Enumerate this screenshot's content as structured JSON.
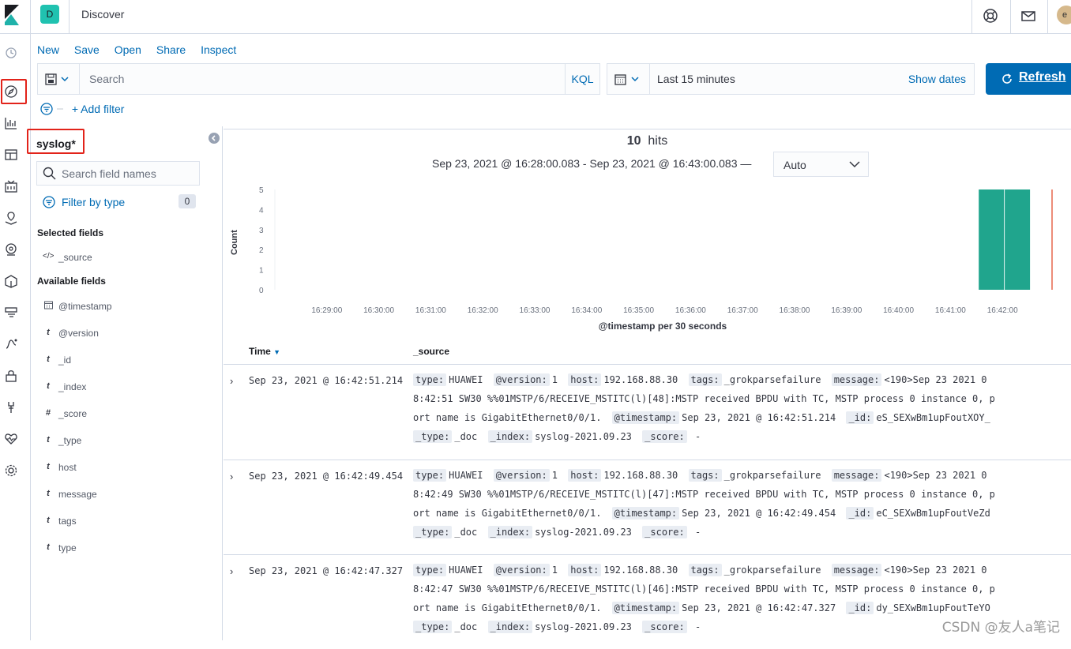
{
  "header": {
    "space_initial": "D",
    "app_title": "Discover",
    "avatar_initial": "e"
  },
  "menu": [
    "New",
    "Save",
    "Open",
    "Share",
    "Inspect"
  ],
  "query": {
    "placeholder": "Search",
    "language": "KQL",
    "time_range": "Last 15 minutes",
    "show_dates": "Show dates",
    "refresh": "Refresh"
  },
  "filters": {
    "add_filter": "+ Add filter"
  },
  "sidebar": {
    "index_pattern": "syslog*",
    "field_search_placeholder": "Search field names",
    "filter_by_type": "Filter by type",
    "filter_count": "0",
    "selected_title": "Selected fields",
    "selected_fields": [
      {
        "type": "</>",
        "name": "_source"
      }
    ],
    "available_title": "Available fields",
    "available_fields": [
      {
        "type": "cal",
        "name": "@timestamp"
      },
      {
        "type": "t",
        "name": "@version"
      },
      {
        "type": "t",
        "name": "_id"
      },
      {
        "type": "t",
        "name": "_index"
      },
      {
        "type": "#",
        "name": "_score"
      },
      {
        "type": "t",
        "name": "_type"
      },
      {
        "type": "t",
        "name": "host"
      },
      {
        "type": "t",
        "name": "message"
      },
      {
        "type": "t",
        "name": "tags"
      },
      {
        "type": "t",
        "name": "type"
      }
    ]
  },
  "results": {
    "hits_count": "10",
    "hits_label": "hits",
    "date_range": "Sep 23, 2021 @ 16:28:00.083 - Sep 23, 2021 @ 16:43:00.083 —",
    "interval": "Auto",
    "col_time": "Time",
    "col_source": "_source"
  },
  "chart_data": {
    "type": "bar",
    "ylabel": "Count",
    "xlabel": "@timestamp per 30 seconds",
    "ylim": [
      0,
      5
    ],
    "yticks": [
      "5",
      "4",
      "3",
      "2",
      "1",
      "0"
    ],
    "xticks": [
      "16:29:00",
      "16:30:00",
      "16:31:00",
      "16:32:00",
      "16:33:00",
      "16:34:00",
      "16:35:00",
      "16:36:00",
      "16:37:00",
      "16:38:00",
      "16:39:00",
      "16:40:00",
      "16:41:00",
      "16:42:00"
    ],
    "bars": [
      {
        "x": "16:42:00",
        "value": 5
      },
      {
        "x": "16:42:30",
        "value": 5
      }
    ],
    "bar_color": "#20a58d"
  },
  "rows": [
    {
      "time": "Sep 23, 2021 @ 16:42:51.214",
      "fields": [
        [
          "type:",
          "HUAWEI"
        ],
        [
          "@version:",
          "1"
        ],
        [
          "host:",
          "192.168.88.30"
        ],
        [
          "tags:",
          "_grokparsefailure"
        ],
        [
          "message:",
          "<190>Sep 23 2021 08:42:51 SW30 %%01MSTP/6/RECEIVE_MSTITC(l)[48]:MSTP received BPDU with TC, MSTP process 0 instance 0, port name is GigabitEthernet0/0/1."
        ],
        [
          "@timestamp:",
          "Sep 23, 2021 @ 16:42:51.214"
        ],
        [
          "_id:",
          "eS_SEXwBm1upFoutXOY_"
        ],
        [
          "_type:",
          "_doc"
        ],
        [
          "_index:",
          "syslog-2021.09.23"
        ],
        [
          "_score:",
          " -"
        ]
      ]
    },
    {
      "time": "Sep 23, 2021 @ 16:42:49.454",
      "fields": [
        [
          "type:",
          "HUAWEI"
        ],
        [
          "@version:",
          "1"
        ],
        [
          "host:",
          "192.168.88.30"
        ],
        [
          "tags:",
          "_grokparsefailure"
        ],
        [
          "message:",
          "<190>Sep 23 2021 08:42:49 SW30 %%01MSTP/6/RECEIVE_MSTITC(l)[47]:MSTP received BPDU with TC, MSTP process 0 instance 0, port name is GigabitEthernet0/0/1."
        ],
        [
          "@timestamp:",
          "Sep 23, 2021 @ 16:42:49.454"
        ],
        [
          "_id:",
          "eC_SEXwBm1upFoutVeZd"
        ],
        [
          "_type:",
          "_doc"
        ],
        [
          "_index:",
          "syslog-2021.09.23"
        ],
        [
          "_score:",
          " -"
        ]
      ]
    },
    {
      "time": "Sep 23, 2021 @ 16:42:47.327",
      "fields": [
        [
          "type:",
          "HUAWEI"
        ],
        [
          "@version:",
          "1"
        ],
        [
          "host:",
          "192.168.88.30"
        ],
        [
          "tags:",
          "_grokparsefailure"
        ],
        [
          "message:",
          "<190>Sep 23 2021 08:42:47 SW30 %%01MSTP/6/RECEIVE_MSTITC(l)[46]:MSTP received BPDU with TC, MSTP process 0 instance 0, port name is GigabitEthernet0/0/1."
        ],
        [
          "@timestamp:",
          "Sep 23, 2021 @ 16:42:47.327"
        ],
        [
          "_id:",
          "dy_SEXwBm1upFoutTeYO"
        ],
        [
          "_type:",
          "_doc"
        ],
        [
          "_index:",
          "syslog-2021.09.23"
        ],
        [
          "_score:",
          " -"
        ]
      ]
    }
  ],
  "watermark": "CSDN @友人a笔记"
}
